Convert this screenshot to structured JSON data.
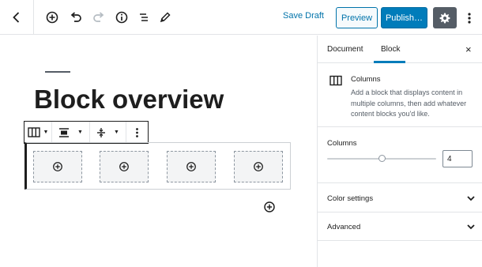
{
  "toolbar": {
    "save_draft": "Save Draft",
    "preview": "Preview",
    "publish": "Publish…"
  },
  "editor": {
    "post_title": "Block overview"
  },
  "sidebar": {
    "tabs": [
      {
        "label": "Document",
        "active": false
      },
      {
        "label": "Block",
        "active": true
      }
    ],
    "close_icon": "×",
    "block_card": {
      "title": "Columns",
      "description": "Add a block that displays content in multiple columns, then add whatever content blocks you'd like."
    },
    "columns_panel": {
      "label": "Columns",
      "value": "4",
      "range_min": 2,
      "range_max": 6,
      "range_value": 4
    },
    "panels": [
      {
        "label": "Color settings"
      },
      {
        "label": "Advanced"
      }
    ]
  },
  "colors": {
    "accent": "#007cba",
    "link": "#0073aa",
    "settings_active": "#555d66"
  }
}
